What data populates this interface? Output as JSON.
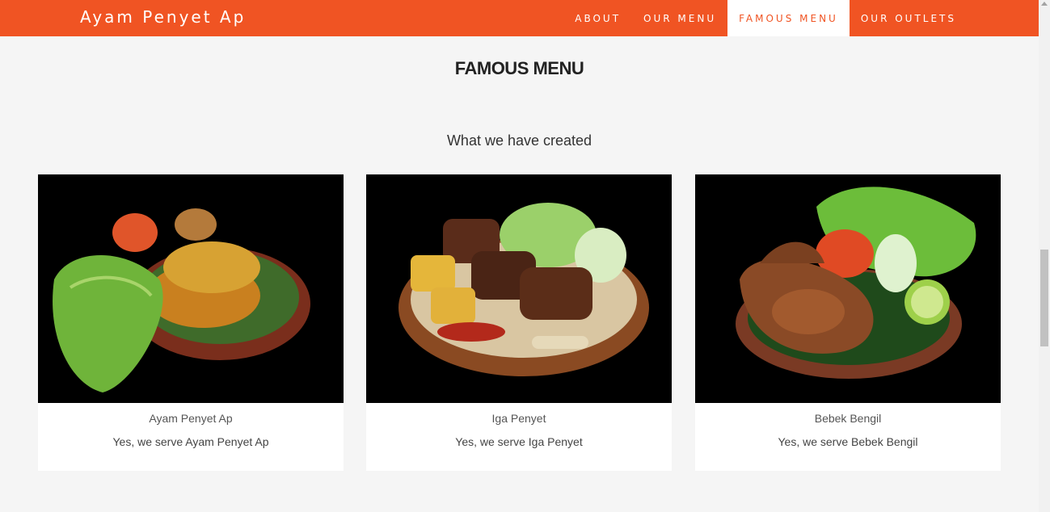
{
  "header": {
    "brand": "Ayam Penyet Ap",
    "nav": [
      {
        "label": "ABOUT"
      },
      {
        "label": "OUR MENU"
      },
      {
        "label": "FAMOUS MENU"
      },
      {
        "label": "OUR OUTLETS"
      }
    ],
    "active_nav": "FAMOUS MENU",
    "accent_color": "#f05423"
  },
  "section": {
    "title": "FAMOUS MENU",
    "subtitle": "What we have created"
  },
  "cards": [
    {
      "title": "Ayam Penyet Ap",
      "description": "Yes, we serve Ayam Penyet Ap",
      "image": "fried-chicken-plate-image"
    },
    {
      "title": "Iga Penyet",
      "description": "Yes, we serve Iga Penyet",
      "image": "beef-ribs-plate-image"
    },
    {
      "title": "Bebek Bengil",
      "description": "Yes, we serve Bebek Bengil",
      "image": "crispy-duck-plate-image"
    }
  ]
}
